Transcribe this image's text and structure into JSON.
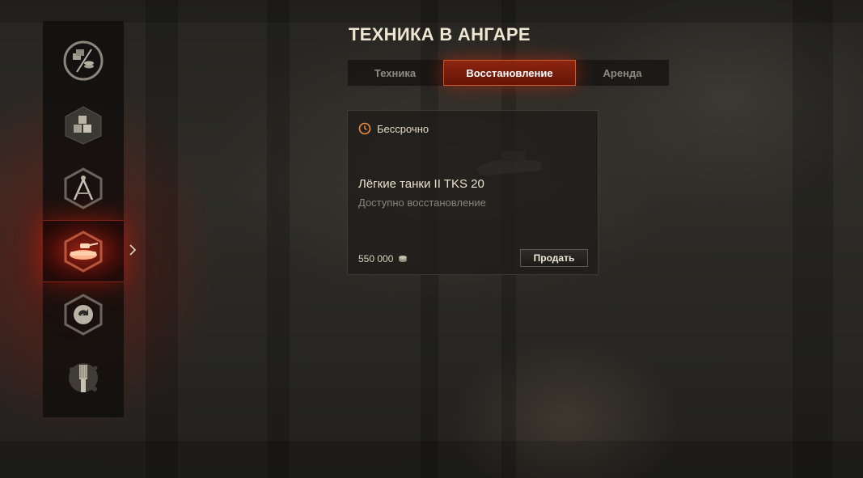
{
  "page": {
    "title": "ТЕХНИКА В АНГАРЕ"
  },
  "tabs": [
    {
      "label": "Техника",
      "active": false
    },
    {
      "label": "Восстановление",
      "active": true
    },
    {
      "label": "Аренда",
      "active": false
    }
  ],
  "sidebar": {
    "items": [
      {
        "icon": "exchange-icon",
        "active": false
      },
      {
        "icon": "boxes-icon",
        "active": false
      },
      {
        "icon": "drafting-compass-icon",
        "active": false
      },
      {
        "icon": "tank-icon",
        "active": true
      },
      {
        "icon": "recycle-icon",
        "active": false
      },
      {
        "icon": "paintbrush-icon",
        "active": false
      }
    ],
    "active_indicator_icon": "chevron-right-icon"
  },
  "card": {
    "term": "Бессрочно",
    "term_icon": "clock-icon",
    "vehicle_name": "Лёгкие танки II TKS 20",
    "status": "Доступно восстановление",
    "price": "550 000",
    "price_icon": "credits-icon",
    "sell_label": "Продать"
  },
  "colors": {
    "accent_red": "#c8280f",
    "accent_orange": "#e67840",
    "text_light": "#ece3cf",
    "text_muted": "#8a857a"
  }
}
